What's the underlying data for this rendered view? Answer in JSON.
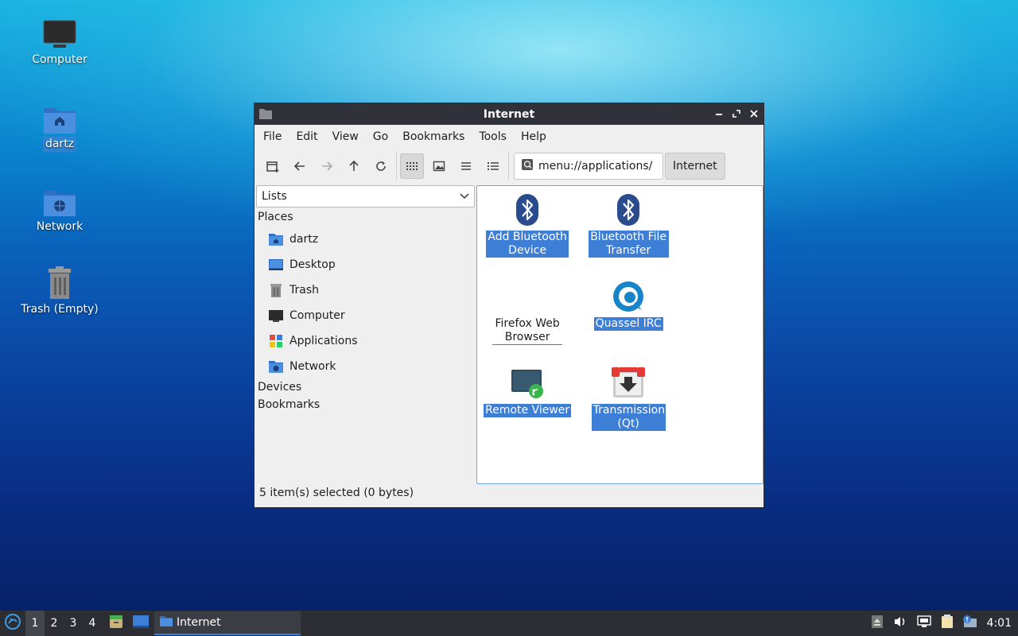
{
  "desktop": {
    "icons": [
      {
        "label": "Computer"
      },
      {
        "label": "dartz"
      },
      {
        "label": "Network"
      },
      {
        "label": "Trash (Empty)"
      }
    ]
  },
  "window": {
    "title": "Internet",
    "menu": [
      "File",
      "Edit",
      "View",
      "Go",
      "Bookmarks",
      "Tools",
      "Help"
    ],
    "location": "menu://applications/",
    "breadcrumb": "Internet",
    "side_mode": "Lists",
    "places_header": "Places",
    "places": [
      {
        "label": "dartz",
        "icon": "home-folder-icon"
      },
      {
        "label": "Desktop",
        "icon": "desktop-icon"
      },
      {
        "label": "Trash",
        "icon": "trash-icon"
      },
      {
        "label": "Computer",
        "icon": "computer-icon"
      },
      {
        "label": "Applications",
        "icon": "applications-icon"
      },
      {
        "label": "Network",
        "icon": "network-folder-icon"
      }
    ],
    "devices_header": "Devices",
    "bookmarks_header": "Bookmarks",
    "apps": [
      {
        "label": "Add Bluetooth Device",
        "icon": "bluetooth-icon",
        "selected": true
      },
      {
        "label": "Bluetooth File Transfer",
        "icon": "bluetooth-icon",
        "selected": true
      },
      {
        "label": "Firefox Web Browser",
        "icon": "",
        "selected": false
      },
      {
        "label": "Quassel IRC",
        "icon": "quassel-icon",
        "selected": true
      },
      {
        "label": "Remote Viewer",
        "icon": "remote-viewer-icon",
        "selected": true
      },
      {
        "label": "Transmission (Qt)",
        "icon": "transmission-icon",
        "selected": true
      }
    ],
    "status": "5 item(s) selected (0 bytes)"
  },
  "taskbar": {
    "workspaces": [
      "1",
      "2",
      "3",
      "4"
    ],
    "active_workspace": "1",
    "task_label": "Internet",
    "clock": "4:01"
  },
  "colors": {
    "selection": "#3d7fd6",
    "titlebar": "#2f3238",
    "taskbar": "#2c2e33"
  }
}
